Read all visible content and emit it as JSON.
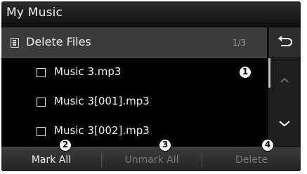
{
  "screen": {
    "title": "My Music"
  },
  "header": {
    "label": "Delete Files",
    "page_indicator": "1/3",
    "icon": "document-list-icon"
  },
  "back_button": {
    "icon": "back-arrow-icon"
  },
  "files": [
    {
      "name": "Music 3.mp3",
      "checked": false
    },
    {
      "name": "Music 3[001].mp3",
      "checked": false
    },
    {
      "name": "Music 3[002].mp3",
      "checked": false
    }
  ],
  "scroll": {
    "up_icon": "chevron-up-icon",
    "down_icon": "chevron-down-icon"
  },
  "footer": {
    "mark_all": "Mark All",
    "unmark_all": "Unmark All",
    "delete": "Delete"
  },
  "callouts": [
    "1",
    "2",
    "3",
    "4"
  ],
  "colors": {
    "background": "#000000",
    "header": "#3b3b3b",
    "enabled_text": "#f0f0f0",
    "disabled_text": "#7a7a7a"
  }
}
